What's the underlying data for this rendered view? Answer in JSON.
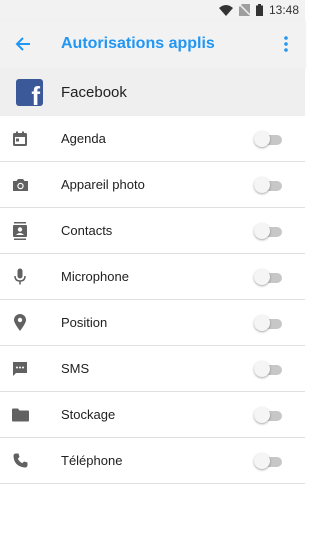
{
  "status_bar": {
    "time": "13:48"
  },
  "app_bar": {
    "title": "Autorisations applis"
  },
  "app_header": {
    "name": "Facebook"
  },
  "permissions": [
    {
      "label": "Agenda",
      "icon": "calendar-icon",
      "enabled": false
    },
    {
      "label": "Appareil photo",
      "icon": "camera-icon",
      "enabled": false
    },
    {
      "label": "Contacts",
      "icon": "contacts-icon",
      "enabled": false
    },
    {
      "label": "Microphone",
      "icon": "microphone-icon",
      "enabled": false
    },
    {
      "label": "Position",
      "icon": "location-icon",
      "enabled": false
    },
    {
      "label": "SMS",
      "icon": "sms-icon",
      "enabled": false
    },
    {
      "label": "Stockage",
      "icon": "folder-icon",
      "enabled": false
    },
    {
      "label": "Téléphone",
      "icon": "phone-icon",
      "enabled": false
    }
  ],
  "colors": {
    "accent": "#2196f3",
    "facebook": "#3b5998",
    "icon": "#616161"
  }
}
